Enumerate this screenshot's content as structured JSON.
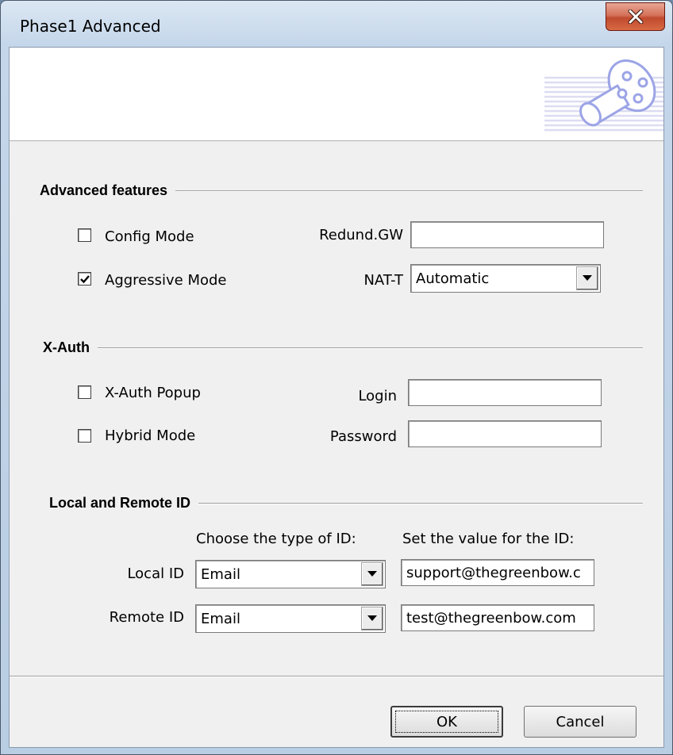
{
  "window": {
    "title": "Phase1 Advanced"
  },
  "advanced": {
    "title": "Advanced features",
    "config_mode": {
      "label": "Config Mode",
      "checked": false
    },
    "aggressive_mode": {
      "label": "Aggressive Mode",
      "checked": true
    },
    "redund_gw": {
      "label": "Redund.GW",
      "value": ""
    },
    "nat_t": {
      "label": "NAT-T",
      "value": "Automatic"
    }
  },
  "xauth": {
    "title": "X-Auth",
    "popup": {
      "label": "X-Auth Popup",
      "checked": false
    },
    "hybrid": {
      "label": "Hybrid Mode",
      "checked": false
    },
    "login": {
      "label": "Login",
      "value": ""
    },
    "password": {
      "label": "Password",
      "value": ""
    }
  },
  "ids": {
    "title": "Local and Remote ID",
    "type_header": "Choose the type of ID:",
    "value_header": "Set the value for the ID:",
    "local": {
      "label": "Local ID",
      "type": "Email",
      "value": "support@thegreenbow.c"
    },
    "remote": {
      "label": "Remote ID",
      "type": "Email",
      "value": "test@thegreenbow.com"
    }
  },
  "buttons": {
    "ok": "OK",
    "cancel": "Cancel"
  },
  "icons": {
    "close": "close-icon",
    "logo": "tunnel-pipe-logo",
    "dropdown": "chevron-down-icon",
    "check": "checkmark-icon"
  }
}
